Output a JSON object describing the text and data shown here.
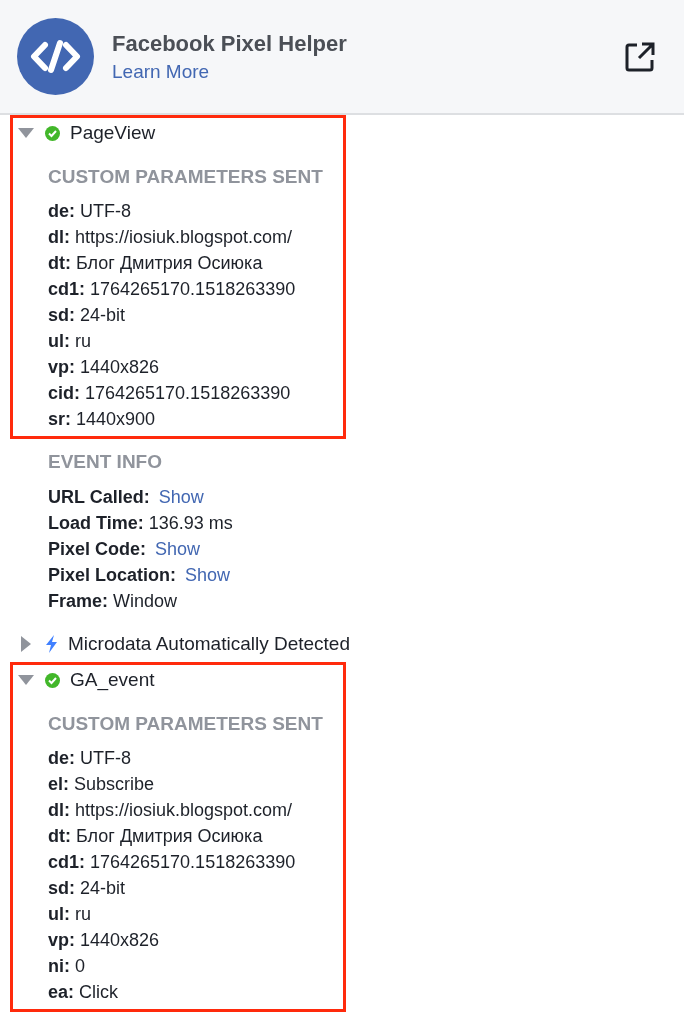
{
  "header": {
    "title": "Facebook Pixel Helper",
    "link": "Learn More"
  },
  "events": [
    {
      "kind": "pixel",
      "name": "PageView",
      "expanded": true,
      "highlighted": true,
      "sections": [
        {
          "title": "CUSTOM PARAMETERS SENT",
          "rows": [
            {
              "key": "de:",
              "value": "UTF-8"
            },
            {
              "key": "dl:",
              "value": "https://iosiuk.blogspot.com/"
            },
            {
              "key": "dt:",
              "value": "Блог Дмитрия Осиюка"
            },
            {
              "key": "cd1:",
              "value": "1764265170.1518263390"
            },
            {
              "key": "sd:",
              "value": "24-bit"
            },
            {
              "key": "ul:",
              "value": "ru"
            },
            {
              "key": "vp:",
              "value": "1440x826"
            },
            {
              "key": "cid:",
              "value": "1764265170.1518263390"
            },
            {
              "key": "sr:",
              "value": "1440x900"
            }
          ]
        },
        {
          "title": "EVENT INFO",
          "rows": [
            {
              "key": "URL Called:",
              "value": "Show",
              "kind": "link"
            },
            {
              "key": "Load Time:",
              "value": "136.93 ms"
            },
            {
              "key": "Pixel Code:",
              "value": "Show",
              "kind": "link"
            },
            {
              "key": "Pixel Location:",
              "value": "Show",
              "kind": "link"
            },
            {
              "key": "Frame:",
              "value": "Window"
            }
          ]
        }
      ]
    },
    {
      "kind": "microdata",
      "name": "Microdata Automatically Detected",
      "expanded": false,
      "highlighted": false
    },
    {
      "kind": "pixel",
      "name": "GA_event",
      "expanded": true,
      "highlighted": true,
      "sections": [
        {
          "title": "CUSTOM PARAMETERS SENT",
          "rows": [
            {
              "key": "de:",
              "value": "UTF-8"
            },
            {
              "key": "el:",
              "value": "Subscribe"
            },
            {
              "key": "dl:",
              "value": "https://iosiuk.blogspot.com/"
            },
            {
              "key": "dt:",
              "value": "Блог Дмитрия Осиюка"
            },
            {
              "key": "cd1:",
              "value": "1764265170.1518263390"
            },
            {
              "key": "sd:",
              "value": "24-bit"
            },
            {
              "key": "ul:",
              "value": "ru"
            },
            {
              "key": "vp:",
              "value": "1440x826"
            },
            {
              "key": "ni:",
              "value": "0"
            },
            {
              "key": "ea:",
              "value": "Click"
            }
          ]
        }
      ]
    }
  ]
}
